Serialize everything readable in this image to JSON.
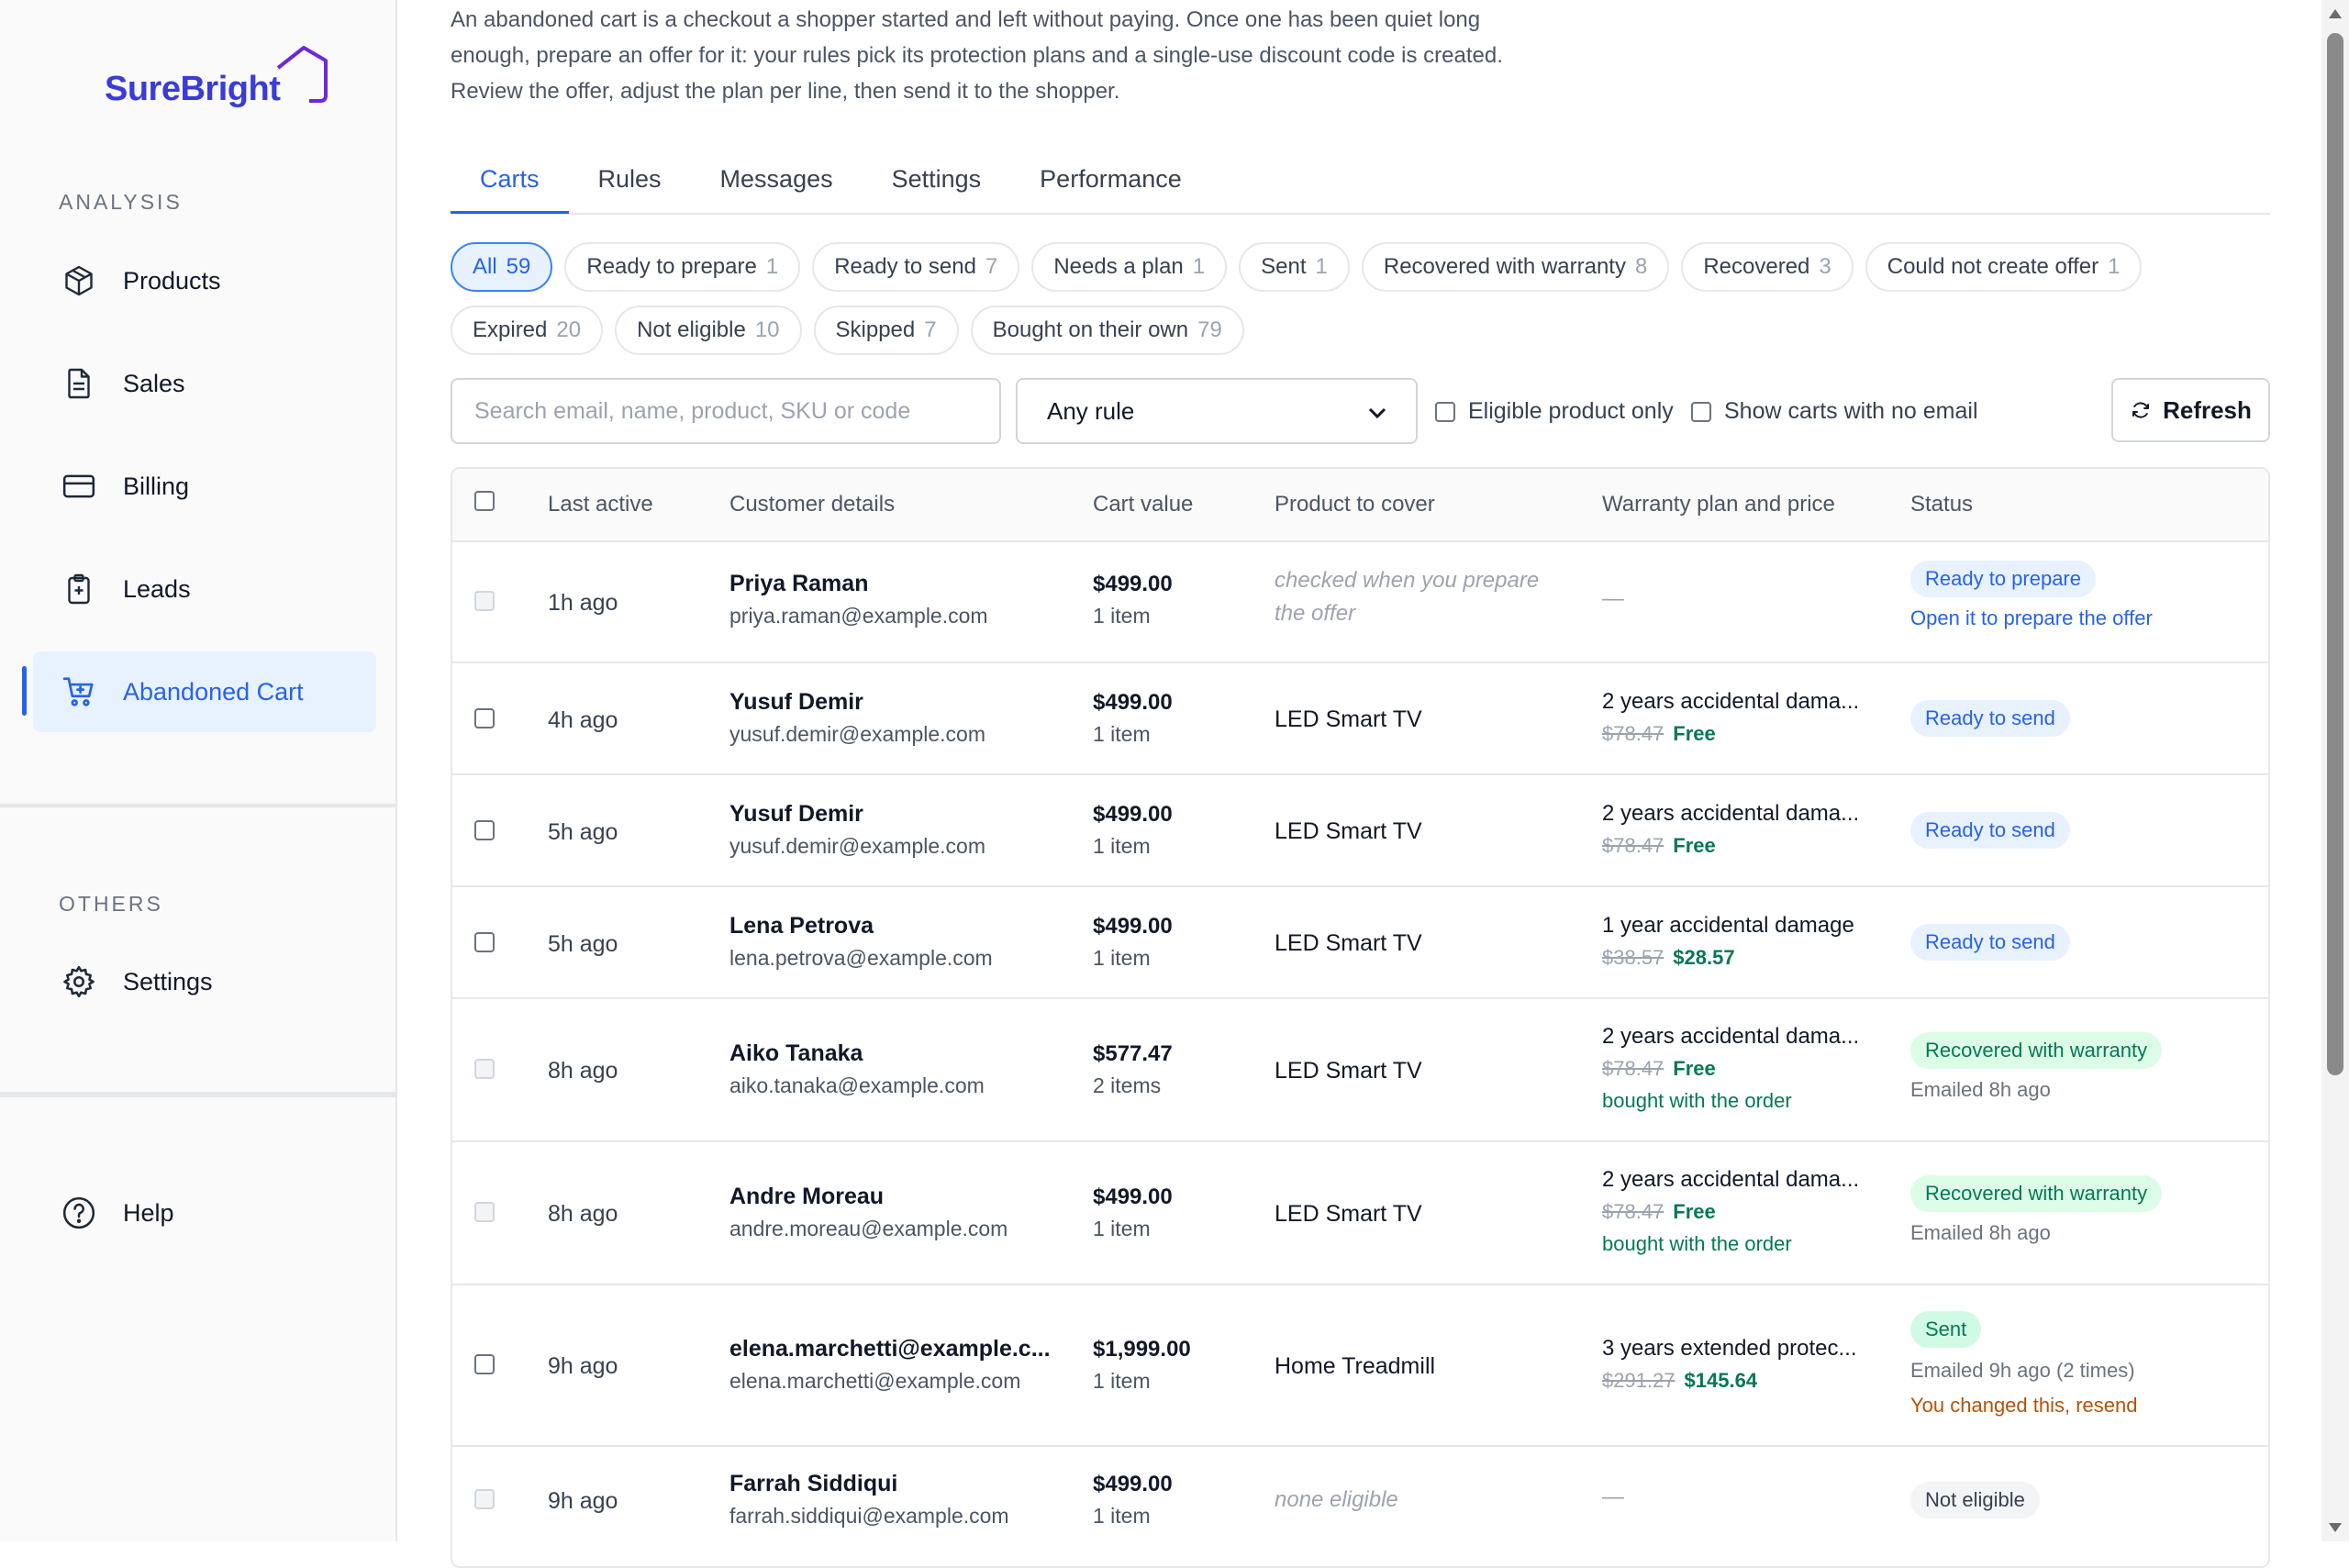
{
  "brand": {
    "name": "SureBright"
  },
  "sidebar": {
    "analysis_label": "ANALYSIS",
    "others_label": "OTHERS",
    "items": [
      {
        "label": "Products",
        "icon": "box-icon"
      },
      {
        "label": "Sales",
        "icon": "document-icon"
      },
      {
        "label": "Billing",
        "icon": "credit-card-icon"
      },
      {
        "label": "Leads",
        "icon": "clipboard-plus-icon"
      },
      {
        "label": "Abandoned Cart",
        "icon": "cart-icon",
        "active": true
      }
    ],
    "settings_label": "Settings",
    "help_label": "Help"
  },
  "intro": "An abandoned cart is a checkout a shopper started and left without paying. Once one has been quiet long enough, prepare an offer for it: your rules pick its protection plans and a single-use discount code is created. Review the offer, adjust the plan per line, then send it to the shopper.",
  "tabs": [
    "Carts",
    "Rules",
    "Messages",
    "Settings",
    "Performance"
  ],
  "filters": [
    {
      "label": "All",
      "count": "59",
      "active": true
    },
    {
      "label": "Ready to prepare",
      "count": "1"
    },
    {
      "label": "Ready to send",
      "count": "7"
    },
    {
      "label": "Needs a plan",
      "count": "1"
    },
    {
      "label": "Sent",
      "count": "1"
    },
    {
      "label": "Recovered with warranty",
      "count": "8"
    },
    {
      "label": "Recovered",
      "count": "3"
    },
    {
      "label": "Could not create offer",
      "count": "1"
    },
    {
      "label": "Expired",
      "count": "20"
    },
    {
      "label": "Not eligible",
      "count": "10"
    },
    {
      "label": "Skipped",
      "count": "7"
    },
    {
      "label": "Bought on their own",
      "count": "79"
    }
  ],
  "controls": {
    "search_placeholder": "Search email, name, product, SKU or code",
    "rule_select": "Any rule",
    "eligible_only": "Eligible product only",
    "no_email": "Show carts with no email",
    "refresh": "Refresh"
  },
  "table": {
    "headers": {
      "last_active": "Last active",
      "customer": "Customer details",
      "value": "Cart value",
      "product": "Product to cover",
      "plan": "Warranty plan and price",
      "status": "Status"
    },
    "rows": [
      {
        "age": "1h ago",
        "name": "Priya Raman",
        "email": "priya.raman@example.com",
        "value": "$499.00",
        "items": "1 item",
        "product_note": "checked when you prepare the offer",
        "plan_dash": "—",
        "status": "Ready to prepare",
        "status_note": "Open it to prepare the offer"
      },
      {
        "age": "4h ago",
        "name": "Yusuf Demir",
        "email": "yusuf.demir@example.com",
        "value": "$499.00",
        "items": "1 item",
        "product": "LED Smart TV",
        "plan": "2 years accidental dama...",
        "old_price": "$78.47",
        "new_price": "Free",
        "status": "Ready to send"
      },
      {
        "age": "5h ago",
        "name": "Yusuf Demir",
        "email": "yusuf.demir@example.com",
        "value": "$499.00",
        "items": "1 item",
        "product": "LED Smart TV",
        "plan": "2 years accidental dama...",
        "old_price": "$78.47",
        "new_price": "Free",
        "status": "Ready to send"
      },
      {
        "age": "5h ago",
        "name": "Lena Petrova",
        "email": "lena.petrova@example.com",
        "value": "$499.00",
        "items": "1 item",
        "product": "LED Smart TV",
        "plan": "1 year accidental damage",
        "old_price": "$38.57",
        "new_price": "$28.57",
        "status": "Ready to send"
      },
      {
        "age": "8h ago",
        "name": "Aiko Tanaka",
        "email": "aiko.tanaka@example.com",
        "value": "$577.47",
        "items": "2 items",
        "product": "LED Smart TV",
        "plan": "2 years accidental dama...",
        "old_price": "$78.47",
        "new_price": "Free",
        "plan_note": "bought with the order",
        "status": "Recovered with warranty",
        "status_note": "Emailed 8h ago"
      },
      {
        "age": "8h ago",
        "name": "Andre Moreau",
        "email": "andre.moreau@example.com",
        "value": "$499.00",
        "items": "1 item",
        "product": "LED Smart TV",
        "plan": "2 years accidental dama...",
        "old_price": "$78.47",
        "new_price": "Free",
        "plan_note": "bought with the order",
        "status": "Recovered with warranty",
        "status_note": "Emailed 8h ago"
      },
      {
        "age": "9h ago",
        "name": "elena.marchetti@example.c...",
        "email": "elena.marchetti@example.com",
        "value": "$1,999.00",
        "items": "1 item",
        "product": "Home Treadmill",
        "plan": "3 years extended protec...",
        "old_price": "$291.27",
        "new_price": "$145.64",
        "status": "Sent",
        "status_note": "Emailed 9h ago (2 times)",
        "status_warn": "You changed this, resend"
      },
      {
        "age": "9h ago",
        "name": "Farrah Siddiqui",
        "email": "farrah.siddiqui@example.com",
        "value": "$499.00",
        "items": "1 item",
        "product_note": "none eligible",
        "plan_dash": "—",
        "status": "Not eligible"
      }
    ]
  }
}
